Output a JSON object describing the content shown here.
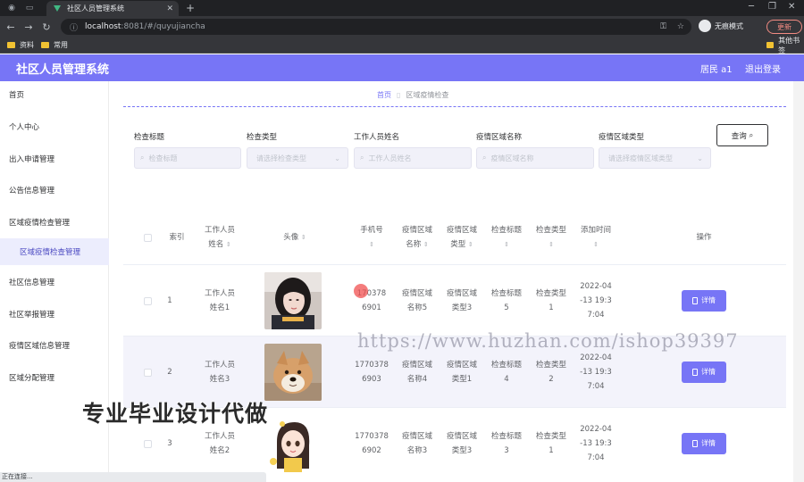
{
  "browser": {
    "tab_title": "社区人员管理系统",
    "url_host": "localhost",
    "url_path": ":8081/#/quyujiancha",
    "profile_label": "无痕模式",
    "update_label": "更新",
    "bookmarks": [
      "资料",
      "常用"
    ],
    "other_bookmarks": "其他书签"
  },
  "header": {
    "title": "社区人员管理系统",
    "user": "居民 a1",
    "logout": "退出登录"
  },
  "sidebar": {
    "items": [
      {
        "label": "首页"
      },
      {
        "label": "个人中心"
      },
      {
        "label": "出入申请管理"
      },
      {
        "label": "公告信息管理"
      },
      {
        "label": "区域疫情检查管理"
      },
      {
        "label": "区域疫情检查管理"
      },
      {
        "label": "社区信息管理"
      },
      {
        "label": "社区举报管理"
      },
      {
        "label": "疫情区域信息管理"
      },
      {
        "label": "区域分配管理"
      }
    ]
  },
  "breadcrumb": {
    "home": "首页",
    "current": "区域疫情检查"
  },
  "filters": [
    {
      "label": "检查标题",
      "placeholder": "检查标题"
    },
    {
      "label": "检查类型",
      "placeholder": "请选择检查类型"
    },
    {
      "label": "工作人员姓名",
      "placeholder": "工作人员姓名"
    },
    {
      "label": "疫情区域名称",
      "placeholder": "疫情区域名称"
    },
    {
      "label": "疫情区域类型",
      "placeholder": "请选择疫情区域类型"
    }
  ],
  "query_label": "查询",
  "table": {
    "headers": {
      "index": "索引",
      "worker_a": "工作人员",
      "worker_b": "姓名",
      "avatar": "头像",
      "phone": "手机号",
      "area_name_a": "疫情区域",
      "area_name_b": "名称",
      "area_type_a": "疫情区域",
      "area_type_b": "类型",
      "title": "检查标题",
      "type": "检查类型",
      "added": "添加时间",
      "ops": "操作"
    },
    "rows": [
      {
        "index": "1",
        "worker_a": "工作人员",
        "worker_b": "姓名1",
        "phone_a": "170378",
        "phone_b": "6901",
        "area_name_a": "疫情区域",
        "area_name_b": "名称5",
        "area_type_a": "疫情区域",
        "area_type_b": "类型3",
        "title_a": "检查标题",
        "title_b": "5",
        "type_a": "检查类型",
        "type_b": "1",
        "time_a": "2022-04",
        "time_b": "-13 19:3",
        "time_c": "7:04",
        "detail": "详情"
      },
      {
        "index": "2",
        "worker_a": "工作人员",
        "worker_b": "姓名3",
        "phone_a": "1770378",
        "phone_b": "6903",
        "area_name_a": "疫情区域",
        "area_name_b": "名称4",
        "area_type_a": "疫情区域",
        "area_type_b": "类型1",
        "title_a": "检查标题",
        "title_b": "4",
        "type_a": "检查类型",
        "type_b": "2",
        "time_a": "2022-04",
        "time_b": "-13 19:3",
        "time_c": "7:04",
        "detail": "详情"
      },
      {
        "index": "3",
        "worker_a": "工作人员",
        "worker_b": "姓名2",
        "phone_a": "1770378",
        "phone_b": "6902",
        "area_name_a": "疫情区域",
        "area_name_b": "名称3",
        "area_type_a": "疫情区域",
        "area_type_b": "类型3",
        "title_a": "检查标题",
        "title_b": "3",
        "type_a": "检查类型",
        "type_b": "1",
        "time_a": "2022-04",
        "time_b": "-13 19:3",
        "time_c": "7:04",
        "detail": "详情"
      }
    ]
  },
  "overlays": {
    "watermark": "https://www.huzhan.com/ishop39397",
    "promo": "专业毕业设计代做",
    "status": "正在连接..."
  },
  "colors": {
    "accent": "#7775f6",
    "sidebar_active_bg": "#ecedfd"
  }
}
